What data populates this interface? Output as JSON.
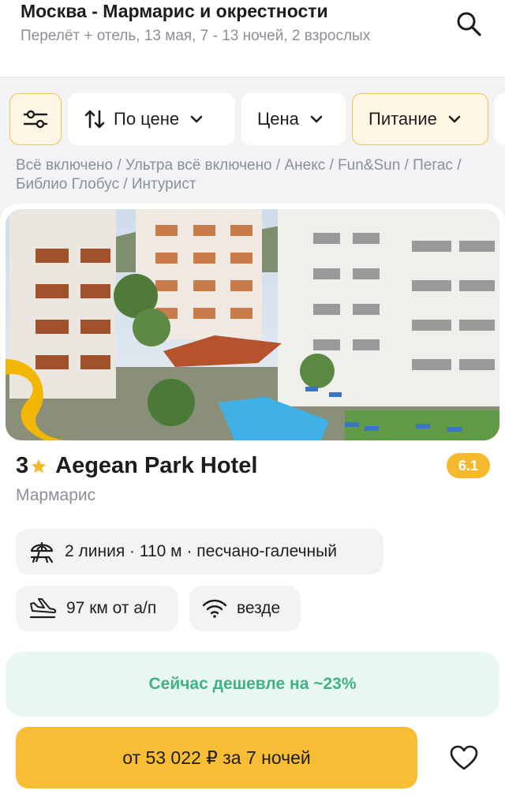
{
  "header": {
    "title": "Москва - Мармарис и окрестности",
    "subtitle": "Перелёт + отель, 13 мая, 7 - 13 ночей, 2 взрослых",
    "search_icon": "search-icon"
  },
  "filters": {
    "settings_icon": "sliders-icon",
    "sort_label": "По цене",
    "price_label": "Цена",
    "food_label": "Питание"
  },
  "operators": "Всё включено / Ультра всё включено / Анекс / Fun&Sun / Пегас / Библио Глобус / Интурист",
  "hotel": {
    "stars": "3",
    "name": "Aegean Park Hotel",
    "rating": "6.1",
    "city": "Мармарис",
    "beach": "2 линия · 110 м · песчано-галечный",
    "airport": "97 км от а/п",
    "wifi": "везде",
    "promo": "Сейчас дешевле на ~23%",
    "price_button": "от 53 022 ₽ за 7 ночей"
  },
  "colors": {
    "accent": "#f8bd34",
    "promo_text": "#3fb287",
    "promo_bg": "#e9f7f1",
    "muted_text": "#8b8f96"
  }
}
